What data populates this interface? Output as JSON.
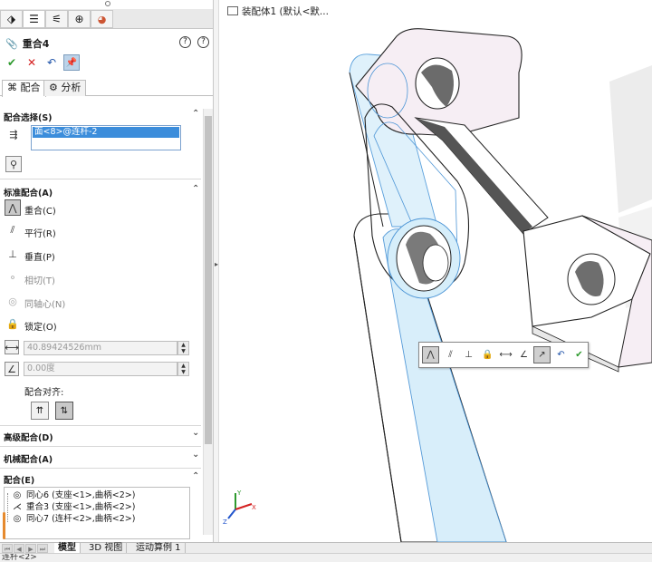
{
  "property_manager": {
    "title": "重合4",
    "help_icon": "?",
    "tabs": {
      "mate": "配合",
      "analysis": "分析"
    },
    "mate_selections": {
      "header": "配合选择(S)",
      "selected": "面<8>@连杆-2"
    },
    "standard_mates": {
      "header": "标准配合(A)",
      "items": [
        {
          "label": "重合(C)",
          "icon": "coincident-icon",
          "selected": true
        },
        {
          "label": "平行(R)",
          "icon": "parallel-icon"
        },
        {
          "label": "垂直(P)",
          "icon": "perpendicular-icon"
        },
        {
          "label": "相切(T)",
          "icon": "tangent-icon",
          "disabled": true
        },
        {
          "label": "同轴心(N)",
          "icon": "concentric-icon",
          "disabled": true
        },
        {
          "label": "锁定(O)",
          "icon": "lock-icon"
        }
      ],
      "distance": "40.89424526mm",
      "angle": "0.00度",
      "alignment_label": "配合对齐:"
    },
    "advanced_mates": "高级配合(D)",
    "mechanical_mates": "机械配合(A)",
    "mates_group": {
      "header": "配合(E)",
      "items": [
        {
          "label": "同心6 (支座<1>,曲柄<2>)",
          "icon": "concentric-mate-icon"
        },
        {
          "label": "重合3 (支座<1>,曲柄<2>)",
          "icon": "coincident-mate-icon"
        },
        {
          "label": "同心7 (连杆<2>,曲柄<2>)",
          "icon": "concentric-mate-icon"
        }
      ]
    }
  },
  "viewport": {
    "tree_header": "装配体1 (默认<默..."
  },
  "bottom_tabs": [
    "模型",
    "3D 视图",
    "运动算例 1"
  ],
  "status_text": "连杆<2>",
  "colors": {
    "selection_blue": "#3c8ddb",
    "link_highlight": "#d6eefa",
    "part_face": "#f6eef4",
    "accept_green": "#2e9a2e",
    "cancel_red": "#d42020"
  }
}
